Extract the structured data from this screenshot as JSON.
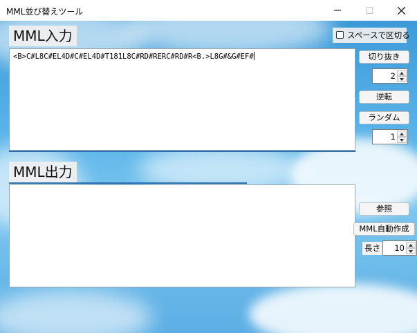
{
  "window": {
    "title": "MML並び替えツール",
    "minimize_icon": "minimize-icon",
    "maximize_icon": "maximize-icon",
    "close_icon": "close-icon"
  },
  "input_section": {
    "heading": "MML入力",
    "text": "<B>C#L8C#EL4D#C#EL4D#T181L8C#RD#RERC#RD#R<B.>L8G#&G#EF#"
  },
  "space_split": {
    "label": "スペースで区切る",
    "checked": false
  },
  "cut_button": "切り抜き",
  "cut_spin": {
    "value": "2"
  },
  "reverse_button": "逆転",
  "random_button": "ランダム",
  "random_spin": {
    "value": "1"
  },
  "output_section": {
    "heading": "MML出力",
    "text": ""
  },
  "browse_button": "参照",
  "auto_mml_button": "MML自動作成",
  "length_label": "長さ",
  "length_spin": {
    "value": "10"
  },
  "colors": {
    "sky": "#4aa6e0",
    "accent_line": "#2a6fb0"
  }
}
